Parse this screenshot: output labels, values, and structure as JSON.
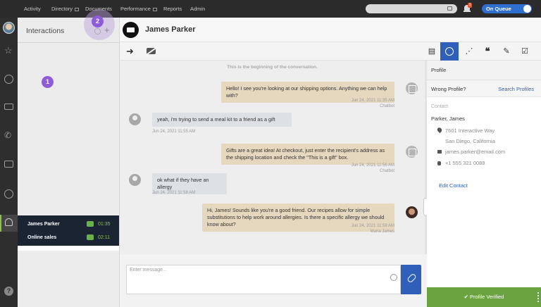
{
  "topnav": [
    {
      "label": "Activity"
    },
    {
      "label": "Directory"
    },
    {
      "label": "Documents"
    },
    {
      "label": "Performance"
    },
    {
      "label": "Reports"
    },
    {
      "label": "Admin"
    }
  ],
  "notifications": {
    "badge": "1"
  },
  "queue": {
    "label": "On Queue"
  },
  "interactions": {
    "title": "Interactions",
    "list": [
      {
        "name": "James Parker",
        "time": "01:35"
      },
      {
        "name": "Online sales",
        "time": "02:11"
      }
    ]
  },
  "callouts": {
    "one": "1",
    "two": "2"
  },
  "contact": {
    "name": "James Parker"
  },
  "chat": {
    "begin": "This is the beginning of the conversation.",
    "messages": [
      {
        "text": "Hello! I see you're looking at our shipping options. Anything we can help with?",
        "time": "Jun 24, 2021 11:35 AM",
        "sender": "Chatbot"
      },
      {
        "text": "yeah, i'm trying to send a meal kit to a friend as a gift",
        "time": "Jun 24, 2021 11:55 AM",
        "sender": ""
      },
      {
        "text": "Gifts are a great idea! At checkout, just enter the recipient's address as the shipping location and check the \"This is a gift\" box.",
        "time": "Jun 24, 2021 11:56 AM",
        "sender": "Chatbot"
      },
      {
        "text": "ok what if they have an allergy",
        "time": "Jun 24, 2021 11:58 AM",
        "sender": ""
      },
      {
        "text": "Hi, James! Sounds like you're a good friend. Our recipes allow for simple substitutions to help work around allergies. Is there a specific allergy we should know about?",
        "time": "Jun 24, 2021 11:59 AM",
        "sender": "Maria James"
      }
    ]
  },
  "composer": {
    "placeholder": "Enter message..."
  },
  "profile": {
    "title": "Profile",
    "wrong_label": "Wrong Profile?",
    "search_link": "Search Profiles",
    "contact_label": "Contact",
    "full_name": "Parker, James",
    "address1": "7601 Interactive Way",
    "address2": "San Diego, California",
    "email": "james.parker@email.com",
    "phone": "+1 555 321 0088",
    "edit": "Edit Contact",
    "verified": "✔ Profile Verified"
  },
  "colors": {
    "accent": "#2f5fb8",
    "verified": "#6aa33f",
    "queue": "#2f6fd0",
    "callout": "#8e5cd9"
  }
}
